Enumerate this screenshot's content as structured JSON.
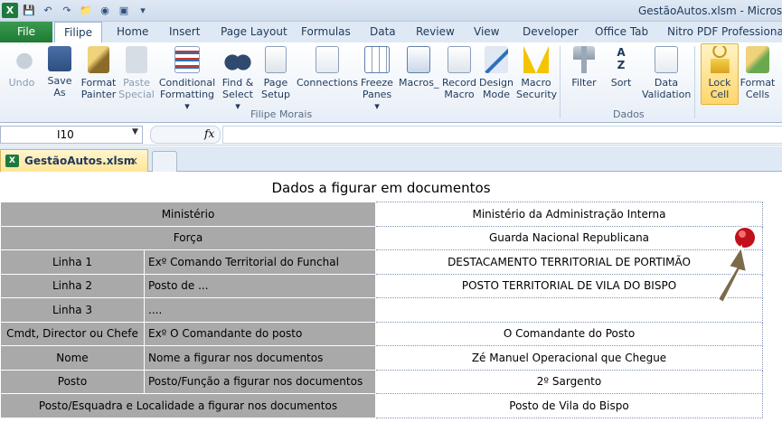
{
  "titlebar": {
    "title": "GestãoAutos.xlsm - Microsoft",
    "app_icon": "X"
  },
  "tabs": {
    "file": "File",
    "items": [
      "Filipe",
      "Home",
      "Insert",
      "Page Layout",
      "Formulas",
      "Data",
      "Review",
      "View",
      "Developer",
      "Office Tab",
      "Nitro PDF Professional"
    ]
  },
  "ribbon": {
    "undo": [
      "Undo",
      ""
    ],
    "save_as": [
      "Save",
      "As"
    ],
    "format_painter": [
      "Format",
      "Painter"
    ],
    "paste_special": [
      "Paste",
      "Special"
    ],
    "conditional_formatting": [
      "Conditional",
      "Formatting ▾"
    ],
    "find_select": [
      "Find &",
      "Select ▾"
    ],
    "page_setup": [
      "Page",
      "Setup"
    ],
    "connections": [
      "Connections",
      ""
    ],
    "freeze_panes": [
      "Freeze",
      "Panes ▾"
    ],
    "macros": [
      "Macros_",
      ""
    ],
    "record_macro": [
      "Record",
      "Macro"
    ],
    "design_mode": [
      "Design",
      "Mode"
    ],
    "macro_security": [
      "Macro",
      "Security"
    ],
    "filter": [
      "Filter",
      ""
    ],
    "sort": [
      "Sort",
      ""
    ],
    "data_validation": [
      "Data",
      "Validation"
    ],
    "lock_cell": [
      "Lock",
      "Cell"
    ],
    "format_cells": [
      "Format",
      "Cells"
    ],
    "group_filipe": "Filipe Morais",
    "group_dados": "Dados"
  },
  "formula_bar": {
    "name_box": "I10",
    "fx": "fx",
    "value": ""
  },
  "doc_tab": {
    "label": "GestãoAutos.xlsm",
    "close": "×"
  },
  "sheet": {
    "title": "Dados a figurar em documentos",
    "rows": [
      {
        "label": "Ministério",
        "sub": "",
        "value": "Ministério da Administração Interna",
        "merged": true
      },
      {
        "label": "Força",
        "sub": "",
        "value": "Guarda Nacional Republicana",
        "merged": true
      },
      {
        "label": "Linha 1",
        "sub": "Exº Comando Territorial do Funchal",
        "value": "DESTACAMENTO TERRITORIAL DE PORTIMÃO",
        "merged": false
      },
      {
        "label": "Linha 2",
        "sub": "Posto de ...",
        "value": "POSTO TERRITORIAL DE VILA DO BISPO",
        "merged": false
      },
      {
        "label": "Linha 3",
        "sub": "....",
        "value": "",
        "merged": false
      },
      {
        "label": "Cmdt, Director ou Chefe",
        "sub": "Exº O Comandante do posto",
        "value": "O Comandante do Posto",
        "merged": false
      },
      {
        "label": "Nome",
        "sub": "Nome a figurar nos documentos",
        "value": "Zé Manuel Operacional que Chegue",
        "merged": false
      },
      {
        "label": "Posto",
        "sub": "Posto/Função a figurar nos documentos",
        "value": "2º Sargento",
        "merged": false
      },
      {
        "label": "Posto/Esquadra e Localidade a figurar nos documentos",
        "sub": "",
        "value": "Posto de Vila do Bispo",
        "merged": true
      }
    ]
  },
  "colors": {
    "label_cell": "#a9a9a9",
    "file_tab": "#1f7a35",
    "ribbon_blue": "#1e395b"
  }
}
